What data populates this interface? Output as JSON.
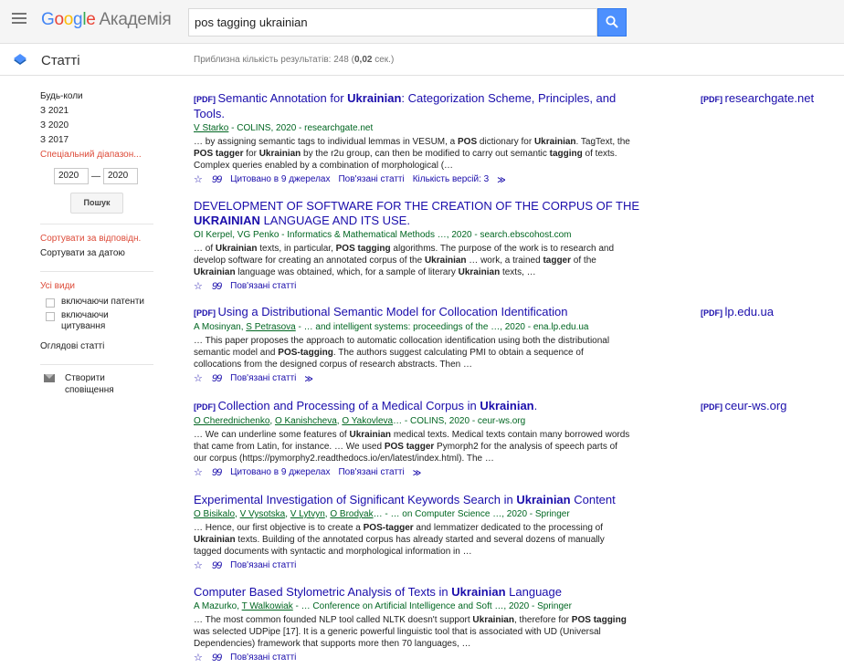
{
  "header": {
    "logo_google": [
      "G",
      "o",
      "o",
      "g",
      "l",
      "e"
    ],
    "logo_suffix": "Академія",
    "search_query": "pos tagging ukrainian"
  },
  "subheader": {
    "section": "Статті",
    "stats_prefix": "Приблизна кількість результатів: 248 (",
    "stats_time": "0,02",
    "stats_suffix": " сек.)"
  },
  "sidebar": {
    "time_filters": [
      "Будь-коли",
      "З 2021",
      "З 2020",
      "З 2017"
    ],
    "custom_range": "Спеціальний діапазон...",
    "year_from": "2020",
    "dash": "—",
    "year_to": "2020",
    "search_button": "Пошук",
    "sort_relevance": "Сортувати за відповідн.",
    "sort_date": "Сортувати за датою",
    "all_types": "Усі види",
    "include_patents": "включаючи патенти",
    "include_citations": "включаючи цитування",
    "review_articles": "Оглядові статті",
    "create_alert": "Створити сповіщення"
  },
  "colors": {
    "link": "#1a0dab",
    "meta": "#006621",
    "red": "#dd4b39"
  },
  "results": [
    {
      "pdf_tag": "[PDF]",
      "title_parts": [
        [
          "Semantic Annotation for ",
          false
        ],
        [
          "Ukrainian",
          true
        ],
        [
          ": Categorization Scheme, Principles, and Tools.",
          false
        ]
      ],
      "meta_parts": [
        [
          "V Starko",
          true
        ],
        [
          " - COLINS, 2020 - researchgate.net",
          false
        ]
      ],
      "snippet_parts": [
        [
          "… by assigning semantic tags to individual lemmas in VESUM, a ",
          false
        ],
        [
          "POS",
          true
        ],
        [
          " dictionary for ",
          false
        ],
        [
          "Ukrainian",
          true
        ],
        [
          ". TagText, the ",
          false
        ],
        [
          "POS tagger",
          true
        ],
        [
          " for ",
          false
        ],
        [
          "Ukrainian",
          true
        ],
        [
          " by the r2u group, can then be modified to carry out semantic ",
          false
        ],
        [
          "tagging",
          true
        ],
        [
          " of texts. Complex queries enabled by a combination of morphological (…",
          false
        ]
      ],
      "actions": [
        "Цитовано в 9 джерелах",
        "Пов'язані статті",
        "Кількість версій: 3"
      ],
      "side_pdf": "researchgate.net"
    },
    {
      "pdf_tag": "",
      "title_parts": [
        [
          "DEVELOPMENT OF SOFTWARE FOR THE CREATION OF THE CORPUS OF THE ",
          false
        ],
        [
          "UKRAINIAN",
          true
        ],
        [
          " LANGUAGE AND ITS USE.",
          false
        ]
      ],
      "meta_parts": [
        [
          "OI Kerpel, VG Penko - Informatics & Mathematical Methods …, 2020 - search.ebscohost.com",
          false
        ]
      ],
      "snippet_parts": [
        [
          "… of ",
          false
        ],
        [
          "Ukrainian",
          true
        ],
        [
          " texts, in particular, ",
          false
        ],
        [
          "POS tagging",
          true
        ],
        [
          " algorithms. The purpose of the work is to research and develop software for creating an annotated corpus of the ",
          false
        ],
        [
          "Ukrainian",
          true
        ],
        [
          " … work, a trained ",
          false
        ],
        [
          "tagger",
          true
        ],
        [
          " of the ",
          false
        ],
        [
          "Ukrainian",
          true
        ],
        [
          " language was obtained, which, for a sample of literary ",
          false
        ],
        [
          "Ukrainian",
          true
        ],
        [
          " texts, …",
          false
        ]
      ],
      "actions": [
        "Пов'язані статті"
      ],
      "side_pdf": ""
    },
    {
      "pdf_tag": "[PDF]",
      "title_parts": [
        [
          "Using a Distributional Semantic Model for Collocation Identification",
          false
        ]
      ],
      "meta_parts": [
        [
          "A Mosinyan, ",
          false
        ],
        [
          "S Petrasova",
          true
        ],
        [
          " - … and intelligent systems: proceedings of the …, 2020 - ena.lp.edu.ua",
          false
        ]
      ],
      "snippet_parts": [
        [
          "… This paper proposes the approach to automatic collocation identification using both the distributional semantic model and ",
          false
        ],
        [
          "POS-tagging",
          true
        ],
        [
          ". The authors suggest calculating PMI to obtain a sequence of collocations from the designed corpus of research abstracts. Then …",
          false
        ]
      ],
      "actions": [
        "Пов'язані статті"
      ],
      "side_pdf": "lp.edu.ua"
    },
    {
      "pdf_tag": "[PDF]",
      "title_parts": [
        [
          "Collection and Processing of a Medical Corpus in ",
          false
        ],
        [
          "Ukrainian",
          true
        ],
        [
          ".",
          false
        ]
      ],
      "meta_parts": [
        [
          "O Cherednichenko",
          true
        ],
        [
          ", ",
          false
        ],
        [
          "O Kanishcheva",
          true
        ],
        [
          ", ",
          false
        ],
        [
          "O Yakovleva",
          true
        ],
        [
          "… - COLINS, 2020 - ceur-ws.org",
          false
        ]
      ],
      "snippet_parts": [
        [
          "… We can underline some features of ",
          false
        ],
        [
          "Ukrainian",
          true
        ],
        [
          " medical texts. Medical texts contain many borrowed words that came from Latin, for instance. … We used ",
          false
        ],
        [
          "POS tagger",
          true
        ],
        [
          " Pymorph2 for the analysis of speech parts of our corpus (https://pymorphy2.readthedocs.io/en/latest/index.html). The …",
          false
        ]
      ],
      "actions": [
        "Цитовано в 9 джерелах",
        "Пов'язані статті"
      ],
      "side_pdf": "ceur-ws.org"
    },
    {
      "pdf_tag": "",
      "title_parts": [
        [
          "Experimental Investigation of Significant Keywords Search in ",
          false
        ],
        [
          "Ukrainian",
          true
        ],
        [
          " Content",
          false
        ]
      ],
      "meta_parts": [
        [
          "O Bisikalo",
          true
        ],
        [
          ", ",
          false
        ],
        [
          "V Vysotska",
          true
        ],
        [
          ", ",
          false
        ],
        [
          "V Lytvyn",
          true
        ],
        [
          ", ",
          false
        ],
        [
          "O Brodyak",
          true
        ],
        [
          "… - … on Computer Science …, 2020 - Springer",
          false
        ]
      ],
      "snippet_parts": [
        [
          "… Hence, our first objective is to create a ",
          false
        ],
        [
          "POS-tagger",
          true
        ],
        [
          " and lemmatizer dedicated to the processing of ",
          false
        ],
        [
          "Ukrainian",
          true
        ],
        [
          " texts. Building of the annotated corpus has already started and several dozens of manually tagged documents with syntactic and morphological information in …",
          false
        ]
      ],
      "actions": [
        "Пов'язані статті"
      ],
      "side_pdf": ""
    },
    {
      "pdf_tag": "",
      "title_parts": [
        [
          "Computer Based Stylometric Analysis of Texts in ",
          false
        ],
        [
          "Ukrainian",
          true
        ],
        [
          " Language",
          false
        ]
      ],
      "meta_parts": [
        [
          "A Mazurko, ",
          false
        ],
        [
          "T Walkowiak",
          true
        ],
        [
          " - … Conference on Artificial Intelligence and Soft …, 2020 - Springer",
          false
        ]
      ],
      "snippet_parts": [
        [
          "… The most common founded NLP tool called NLTK doesn't support ",
          false
        ],
        [
          "Ukrainian",
          true
        ],
        [
          ", therefore for ",
          false
        ],
        [
          "POS tagging",
          true
        ],
        [
          " was selected UDPipe [17]. It is a generic powerful linguistic tool that is associated with UD (Universal Dependencies) framework that supports more then 70 languages, …",
          false
        ]
      ],
      "actions": [
        "Пов'язані статті"
      ],
      "side_pdf": ""
    }
  ],
  "icons": {
    "star": "☆",
    "cite": "99",
    "more": "≫"
  }
}
